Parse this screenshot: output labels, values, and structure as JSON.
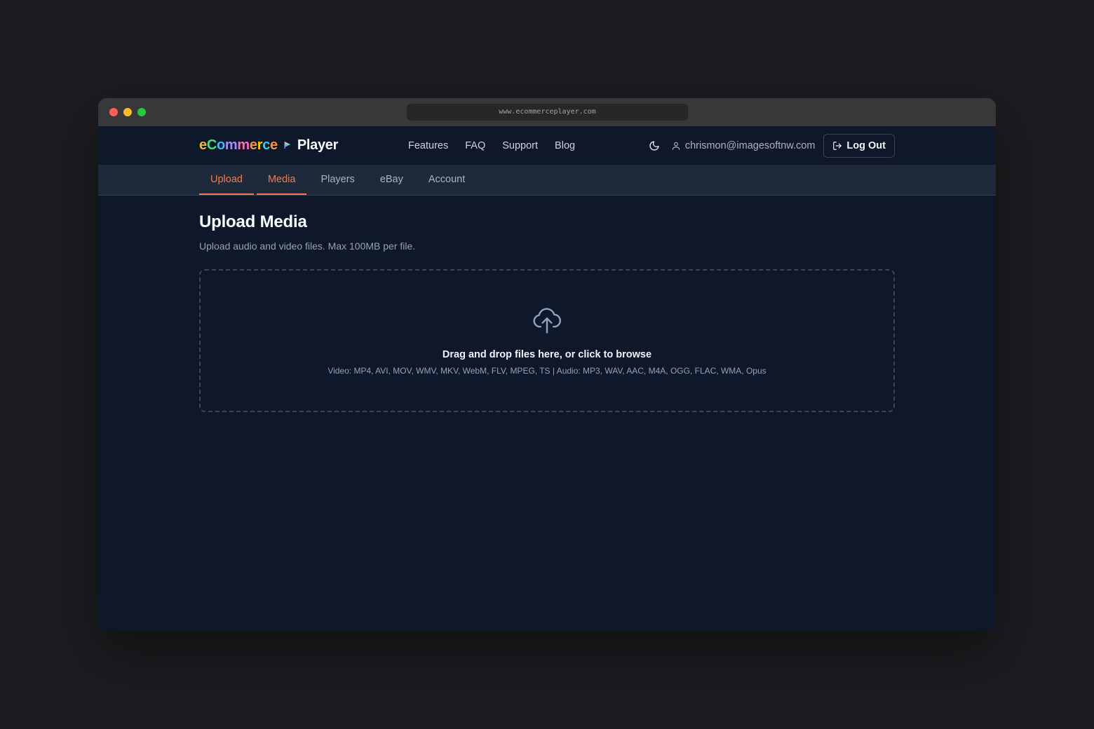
{
  "browser": {
    "url": "www.ecommerceplayer.com"
  },
  "header": {
    "logo": {
      "segments": [
        "e",
        "C",
        "o",
        "m",
        "m",
        "e",
        "r",
        "c",
        "e"
      ],
      "product": "Player"
    },
    "nav": [
      "Features",
      "FAQ",
      "Support",
      "Blog"
    ],
    "user_email": "chrismon@imagesoftnw.com",
    "logout_label": "Log Out"
  },
  "tabs": [
    {
      "label": "Upload",
      "active": true
    },
    {
      "label": "Media",
      "active": true
    },
    {
      "label": "Players",
      "active": false
    },
    {
      "label": "eBay",
      "active": false
    },
    {
      "label": "Account",
      "active": false
    }
  ],
  "main": {
    "title": "Upload Media",
    "subtitle": "Upload audio and video files. Max 100MB per file.",
    "dropzone": {
      "prompt": "Drag and drop files here, or click to browse",
      "formats": "Video: MP4, AVI, MOV, WMV, MKV, WebM, FLV, MPEG, TS | Audio: MP3, WAV, AAC, M4A, OGG, FLAC, WMA, Opus"
    }
  },
  "colors": {
    "accent": "#f47b4f",
    "background": "#0f172a",
    "subnav": "#1e293b"
  }
}
